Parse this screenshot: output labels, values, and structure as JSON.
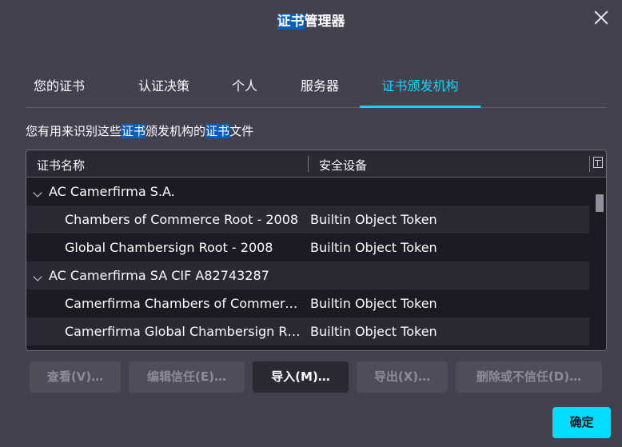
{
  "window": {
    "title_highlight": "证书",
    "title_rest": "管理器"
  },
  "tabs": [
    {
      "label": "您的证书"
    },
    {
      "label": "认证决策"
    },
    {
      "label": "个人"
    },
    {
      "label": "服务器"
    },
    {
      "label": "证书颁发机构"
    }
  ],
  "active_tab": "证书颁发机构",
  "description": {
    "p1": "您有用来识别这些",
    "h1": "证书",
    "p2": "颁发机构的",
    "h2": "证书",
    "p3": "文件"
  },
  "tree": {
    "columns": {
      "name": "证书名称",
      "device": "安全设备"
    },
    "groups": [
      {
        "name": "AC Camerfirma S.A.",
        "items": [
          {
            "name": "Chambers of Commerce Root - 2008",
            "device": "Builtin Object Token"
          },
          {
            "name": "Global Chambersign Root - 2008",
            "device": "Builtin Object Token"
          }
        ]
      },
      {
        "name": "AC Camerfirma SA CIF A82743287",
        "items": [
          {
            "name": "Camerfirma Chambers of Commerc…",
            "device": "Builtin Object Token"
          },
          {
            "name": "Camerfirma Global Chambersign R…",
            "device": "Builtin Object Token"
          }
        ]
      }
    ]
  },
  "buttons": {
    "view": "查看(V)…",
    "edit_trust": "编辑信任(E)…",
    "import": "导入(M)…",
    "export": "导出(X)…",
    "delete": "删除或不信任(D)…",
    "ok": "确定"
  },
  "colors": {
    "accent": "#00ddff",
    "selection_highlight": "#0a5ebc",
    "background": "#42414d"
  }
}
